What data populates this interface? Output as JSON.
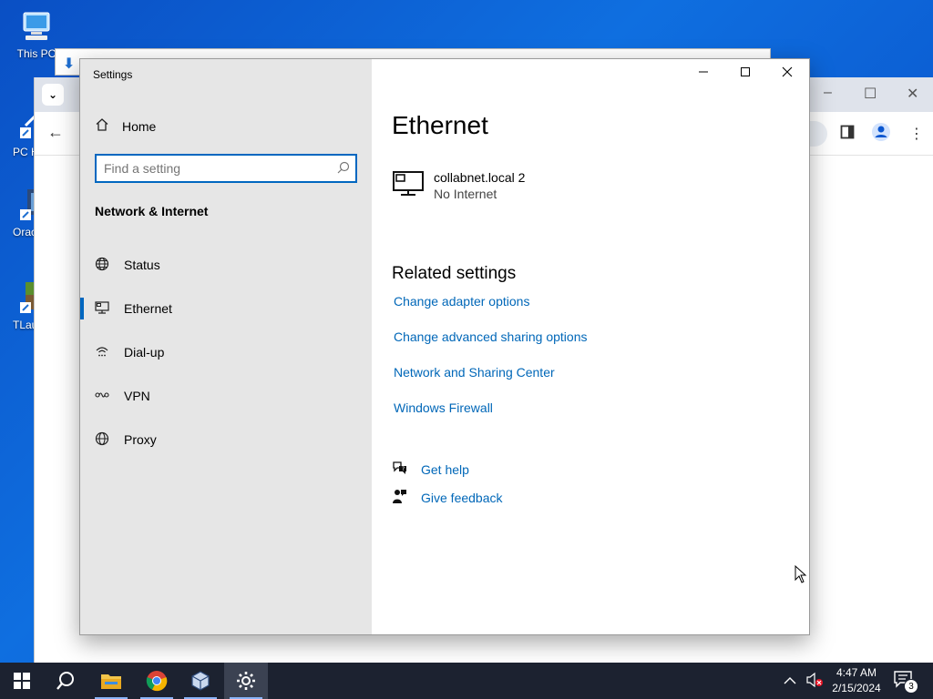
{
  "desktop": {
    "icons": [
      {
        "label": "This PC",
        "icon": "computer-icon"
      },
      {
        "label": "PC H Ch",
        "icon": "shortcut-icon"
      },
      {
        "label": "Orac Virtu",
        "icon": "virtualbox-icon"
      },
      {
        "label": "TLau",
        "icon": "minecraft-icon"
      }
    ]
  },
  "browser": {
    "window_controls": [
      "–",
      "☐",
      "✕"
    ]
  },
  "settings": {
    "window_title": "Settings",
    "home_label": "Home",
    "search_placeholder": "Find a setting",
    "section_title": "Network & Internet",
    "nav": [
      {
        "label": "Status",
        "icon": "globe-status-icon"
      },
      {
        "label": "Ethernet",
        "icon": "ethernet-icon",
        "selected": true
      },
      {
        "label": "Dial-up",
        "icon": "dialup-icon"
      },
      {
        "label": "VPN",
        "icon": "vpn-icon"
      },
      {
        "label": "Proxy",
        "icon": "globe-icon"
      }
    ],
    "page_title": "Ethernet",
    "connection": {
      "name": "collabnet.local 2",
      "status": "No Internet"
    },
    "related_title": "Related settings",
    "related_links": [
      "Change adapter options",
      "Change advanced sharing options",
      "Network and Sharing Center",
      "Windows Firewall"
    ],
    "get_help": "Get help",
    "give_feedback": "Give feedback",
    "accent_color": "#0067c0"
  },
  "taskbar": {
    "time": "4:47 AM",
    "date": "2/15/2024",
    "notification_count": "3",
    "apps": [
      "start-icon",
      "search-icon",
      "file-explorer-icon",
      "chrome-icon",
      "virtualbox-icon",
      "settings-icon"
    ]
  }
}
